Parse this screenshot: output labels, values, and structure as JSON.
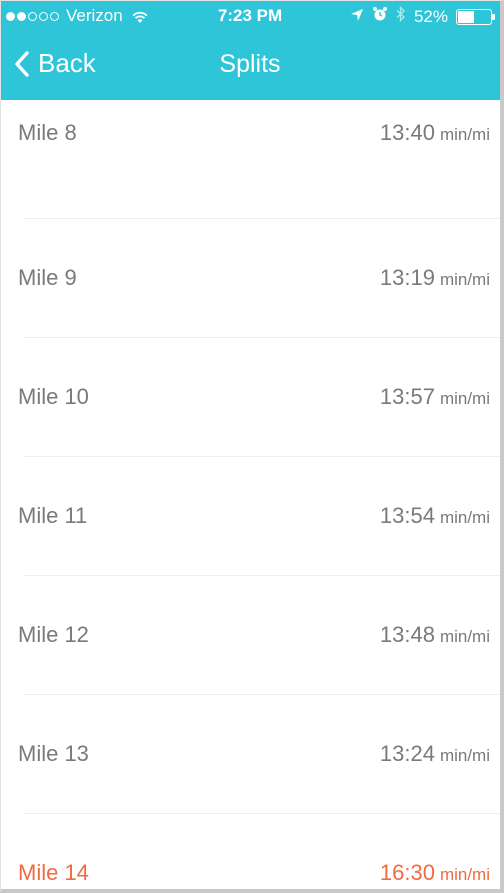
{
  "status_bar": {
    "carrier": "Verizon",
    "signal_bars": 2,
    "time": "7:23 PM",
    "battery_percent": "52%",
    "battery_level": 0.52
  },
  "nav": {
    "back_label": "Back",
    "title": "Splits"
  },
  "colors": {
    "accent": "#2ec5d8",
    "highlight": "#f06b40",
    "text": "#7a7a7a"
  },
  "splits": [
    {
      "label": "Mile 8",
      "pace": "13:40",
      "unit": "min/mi",
      "highlight": false
    },
    {
      "label": "Mile 9",
      "pace": "13:19",
      "unit": "min/mi",
      "highlight": false
    },
    {
      "label": "Mile 10",
      "pace": "13:57",
      "unit": "min/mi",
      "highlight": false
    },
    {
      "label": "Mile 11",
      "pace": "13:54",
      "unit": "min/mi",
      "highlight": false
    },
    {
      "label": "Mile 12",
      "pace": "13:48",
      "unit": "min/mi",
      "highlight": false
    },
    {
      "label": "Mile 13",
      "pace": "13:24",
      "unit": "min/mi",
      "highlight": false
    },
    {
      "label": "Mile 14",
      "pace": "16:30",
      "unit": "min/mi",
      "highlight": true
    }
  ]
}
